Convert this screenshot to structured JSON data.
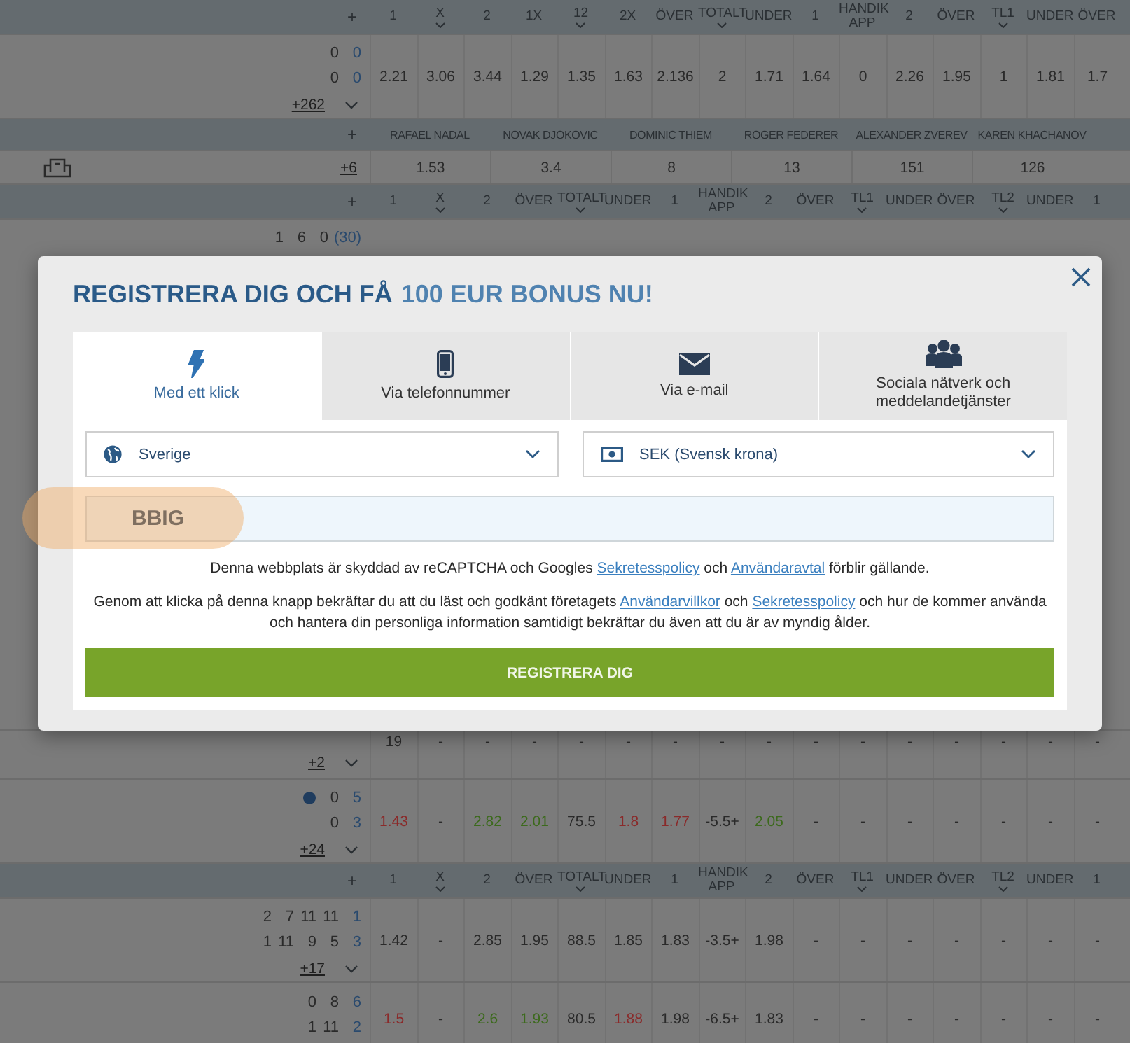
{
  "rows": [
    {
      "kind": "header",
      "plus": "+",
      "columns": [
        {
          "label": "1",
          "caret": false
        },
        {
          "label": "X",
          "caret": true
        },
        {
          "label": "2",
          "caret": false
        },
        {
          "label": "1X",
          "caret": false
        },
        {
          "label": "12",
          "caret": true
        },
        {
          "label": "2X",
          "caret": false
        },
        {
          "label": "ÖVER",
          "caret": false
        },
        {
          "label": "TOTALT",
          "caret": true
        },
        {
          "label": "UNDER",
          "caret": false
        },
        {
          "label": "1",
          "caret": false
        },
        {
          "label": "HANDIK APP",
          "caret": false
        },
        {
          "label": "2",
          "caret": false
        },
        {
          "label": "ÖVER",
          "caret": false
        },
        {
          "label": "TL1",
          "caret": true
        },
        {
          "label": "UNDER",
          "caret": false
        },
        {
          "label": "ÖVER",
          "caret": false
        }
      ]
    },
    {
      "kind": "match",
      "scores": [
        {
          "cells": [
            "0",
            "0"
          ],
          "serving": false
        },
        {
          "cells": [
            "0",
            "0"
          ],
          "serving": false
        }
      ],
      "more": "+262",
      "odds": [
        "2.21",
        "3.06",
        "3.44",
        "1.29",
        "1.35",
        "1.63",
        "2.136",
        "2",
        "1.71",
        "1.64",
        "0",
        "2.26",
        "1.95",
        "1",
        "1.81",
        "1.7"
      ]
    },
    {
      "kind": "names",
      "plus": "+",
      "names": [
        "RAFAEL NADAL",
        "NOVAK DJOKOVIC",
        "DOMINIC THIEM",
        "ROGER FEDERER",
        "ALEXANDER ZVEREV",
        "KAREN KHACHANOV"
      ]
    },
    {
      "kind": "outright",
      "more": "+6",
      "odds": [
        "1.53",
        "3.4",
        "8",
        "13",
        "151",
        "126"
      ]
    },
    {
      "kind": "header",
      "plus": "+",
      "columns": [
        {
          "label": "1",
          "caret": false
        },
        {
          "label": "X",
          "caret": true
        },
        {
          "label": "2",
          "caret": false
        },
        {
          "label": "ÖVER",
          "caret": false
        },
        {
          "label": "TOTALT",
          "caret": true
        },
        {
          "label": "UNDER",
          "caret": false
        },
        {
          "label": "1",
          "caret": false
        },
        {
          "label": "HANDIK APP",
          "caret": false
        },
        {
          "label": "2",
          "caret": false
        },
        {
          "label": "ÖVER",
          "caret": false
        },
        {
          "label": "TL1",
          "caret": true
        },
        {
          "label": "UNDER",
          "caret": false
        },
        {
          "label": "ÖVER",
          "caret": false
        },
        {
          "label": "TL2",
          "caret": true
        },
        {
          "label": "UNDER",
          "caret": false
        },
        {
          "label": "1",
          "caret": false
        }
      ]
    },
    {
      "kind": "covered",
      "scores": [
        {
          "cells": [
            "1",
            "6",
            "0",
            "(30)"
          ],
          "serving": false
        }
      ]
    },
    {
      "kind": "cut",
      "more": "+2",
      "odds": [
        "19",
        "-",
        "-",
        "-",
        "-",
        "-",
        "-",
        "-",
        "-",
        "-",
        "-",
        "-",
        "-",
        "-",
        "-",
        "-"
      ]
    },
    {
      "kind": "match",
      "scores": [
        {
          "cells": [
            "0",
            "5"
          ],
          "serving": true
        },
        {
          "cells": [
            "0",
            "3"
          ],
          "serving": false
        }
      ],
      "more": "+24",
      "odds": [
        {
          "value": "1.43",
          "up": false,
          "down": true
        },
        {
          "value": "-",
          "up": false,
          "down": false
        },
        {
          "value": "2.82",
          "up": true,
          "down": false
        },
        {
          "value": "2.01",
          "up": true,
          "down": false
        },
        {
          "value": "75.5",
          "up": false,
          "down": false
        },
        {
          "value": "1.8",
          "up": false,
          "down": true
        },
        {
          "value": "1.77",
          "up": false,
          "down": true
        },
        {
          "value": "-5.5+",
          "up": false,
          "down": false
        },
        {
          "value": "2.05",
          "up": true,
          "down": false
        },
        {
          "value": "-",
          "up": false,
          "down": false
        },
        {
          "value": "-",
          "up": false,
          "down": false
        },
        {
          "value": "-",
          "up": false,
          "down": false
        },
        {
          "value": "-",
          "up": false,
          "down": false
        },
        {
          "value": "-",
          "up": false,
          "down": false
        },
        {
          "value": "-",
          "up": false,
          "down": false
        },
        {
          "value": "-",
          "up": false,
          "down": false
        }
      ]
    },
    {
      "kind": "header",
      "plus": "+",
      "columns": [
        {
          "label": "1",
          "caret": false
        },
        {
          "label": "X",
          "caret": true
        },
        {
          "label": "2",
          "caret": false
        },
        {
          "label": "ÖVER",
          "caret": false
        },
        {
          "label": "TOTALT",
          "caret": true
        },
        {
          "label": "UNDER",
          "caret": false
        },
        {
          "label": "1",
          "caret": false
        },
        {
          "label": "HANDIK APP",
          "caret": false
        },
        {
          "label": "2",
          "caret": false
        },
        {
          "label": "ÖVER",
          "caret": false
        },
        {
          "label": "TL1",
          "caret": true
        },
        {
          "label": "UNDER",
          "caret": false
        },
        {
          "label": "ÖVER",
          "caret": false
        },
        {
          "label": "TL2",
          "caret": true
        },
        {
          "label": "UNDER",
          "caret": false
        },
        {
          "label": "1",
          "caret": false
        }
      ]
    },
    {
      "kind": "match",
      "scores": [
        {
          "cells": [
            "2",
            "7",
            "11",
            "11",
            "1"
          ],
          "serving": false
        },
        {
          "cells": [
            "1",
            "11",
            "9",
            "5",
            "3"
          ],
          "serving": false
        }
      ],
      "more": "+17",
      "odds": [
        "1.42",
        "-",
        "2.85",
        "1.95",
        "88.5",
        "1.85",
        "1.83",
        "-3.5+",
        "1.98",
        "-",
        "-",
        "-",
        "-",
        "-",
        "-",
        "-"
      ]
    },
    {
      "kind": "last",
      "scores": [
        {
          "cells": [
            "0",
            "8",
            "6"
          ],
          "serving": false
        },
        {
          "cells": [
            "1",
            "11",
            "2"
          ],
          "serving": false
        }
      ],
      "odds": [
        {
          "value": "1.5",
          "up": false,
          "down": true
        },
        {
          "value": "-",
          "up": false,
          "down": false
        },
        {
          "value": "2.6",
          "up": true,
          "down": false
        },
        {
          "value": "1.93",
          "up": true,
          "down": false
        },
        {
          "value": "80.5",
          "up": false,
          "down": false
        },
        {
          "value": "1.88",
          "up": false,
          "down": true
        },
        {
          "value": "1.98",
          "up": false,
          "down": false
        },
        {
          "value": "-6.5+",
          "up": false,
          "down": false
        },
        {
          "value": "1.83",
          "up": false,
          "down": false
        },
        {
          "value": "-",
          "up": false,
          "down": false
        },
        {
          "value": "-",
          "up": false,
          "down": false
        },
        {
          "value": "-",
          "up": false,
          "down": false
        },
        {
          "value": "-",
          "up": false,
          "down": false
        },
        {
          "value": "-",
          "up": false,
          "down": false
        },
        {
          "value": "-",
          "up": false,
          "down": false
        },
        {
          "value": "-",
          "up": false,
          "down": false
        }
      ]
    }
  ],
  "modal": {
    "title": "REGISTRERA DIG OCH FÅ",
    "title_highlight": "100 EUR BONUS NU!",
    "tabs": [
      {
        "kind": "bolt",
        "label": "Med ett klick",
        "selected": true
      },
      {
        "kind": "phone",
        "label": "Via telefonnummer",
        "selected": false
      },
      {
        "kind": "mail",
        "label": "Via e-mail",
        "selected": false
      },
      {
        "kind": "people",
        "label": "Sociala nätverk och meddelandetjänster",
        "selected": false
      }
    ],
    "country": {
      "value": "Sverige"
    },
    "currency": {
      "value": "SEK (Svensk krona)"
    },
    "promo": {
      "value": "BBIG",
      "highlighted": true
    },
    "recaptcha": [
      {
        "text": "Denna webbplats är skyddad av reCAPTCHA och Googles ",
        "link": false
      },
      {
        "text": "Sekretesspolicy",
        "link": true
      },
      {
        "text": " och ",
        "link": false
      },
      {
        "text": "Användaravtal",
        "link": true
      },
      {
        "text": " förblir gällande.",
        "link": false
      }
    ],
    "consent": [
      {
        "text": "Genom att klicka på denna knapp bekräftar du att du läst och godkänt företagets ",
        "link": false
      },
      {
        "text": "Användarvillkor",
        "link": true
      },
      {
        "text": " och ",
        "link": false
      },
      {
        "text": "Sekretesspolicy",
        "link": true
      },
      {
        "text": " och hur de kommer använda och hantera din personliga information samtidigt bekräftar du även att du är av myndig ålder.",
        "link": false
      }
    ],
    "submit": "REGISTRERA DIG"
  }
}
